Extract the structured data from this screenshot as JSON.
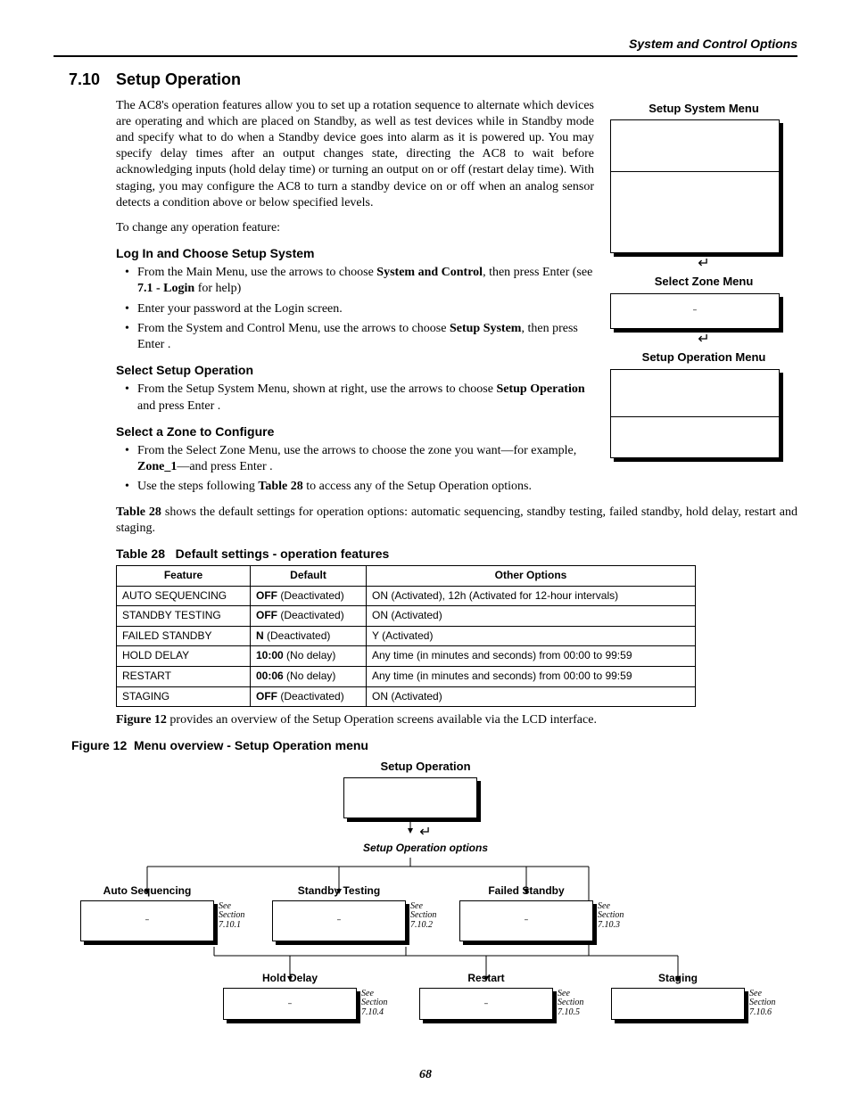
{
  "running_header": "System and Control Options",
  "section": {
    "num": "7.10",
    "title": "Setup Operation"
  },
  "paras": {
    "intro": "The AC8's operation features allow you to set up a rotation sequence to alternate which devices are operating and which are placed on Standby, as well as test devices while in Standby mode and specify what to do when a Standby device goes into alarm as it is powered up. You may specify delay times after an output changes state, directing the AC8 to wait before acknowledging inputs (hold delay time) or turning an output on or off (restart delay time). With staging, you may configure the AC8 to turn a standby device on or off when an analog sensor detects a condition above or below specified levels.",
    "change_any": "To change any operation feature:",
    "sub1": "Log In and Choose Setup System",
    "b1a_pre": "From the Main Menu, use the arrows ",
    "b1a_mid": " to choose ",
    "b1a_bold1": "System and Control",
    "b1a_rest": ", then press Enter  (see ",
    "b1a_bold2": "7.1 - Login",
    "b1a_end": " for help)",
    "b1b": "Enter your password at the Login screen.",
    "b1c_pre": "From the System and Control Menu, use the arrows ",
    "b1c_mid": " to choose ",
    "b1c_bold": "Setup System",
    "b1c_rest": ", then press Enter  .",
    "sub2": "Select Setup Operation",
    "b2a_pre": "From the Setup System Menu, shown at right, use the arrows ",
    "b2a_mid": " to choose ",
    "b2a_bold": "Setup Operation",
    "b2a_rest": " and press Enter  .",
    "sub3": "Select a Zone to Configure",
    "b3a_pre": "From the Select Zone Menu, use the arrows ",
    "b3a_mid": " to choose the zone you want—for example, ",
    "b3a_bold": "Zone_1",
    "b3a_rest": "—and press Enter  .",
    "b3b_pre": "Use the steps following ",
    "b3b_bold": "Table 28",
    "b3b_rest": " to access any of the Setup Operation options.",
    "table_lead_pre": "",
    "table_lead_bold": "Table 28",
    "table_lead_rest": " shows the default settings for operation options: automatic sequencing, standby testing, failed standby, hold delay, restart and staging.",
    "fig_lead_bold": "Figure 12",
    "fig_lead_rest": " provides an overview of the Setup Operation screens available via the LCD interface."
  },
  "side_menus": {
    "m1": "Setup System Menu",
    "m2": "Select Zone Menu",
    "m3": "Setup Operation Menu"
  },
  "table28": {
    "caption_num": "Table 28",
    "caption_txt": "Default settings - operation features",
    "headers": [
      "Feature",
      "Default",
      "Other Options"
    ],
    "rows": [
      {
        "f": "AUTO SEQUENCING",
        "d_bold": "OFF",
        "d_rest": " (Deactivated)",
        "o": "ON (Activated), 12h (Activated for 12-hour intervals)"
      },
      {
        "f": "STANDBY TESTING",
        "d_bold": "OFF",
        "d_rest": " (Deactivated)",
        "o": "ON (Activated)"
      },
      {
        "f": "FAILED STANDBY",
        "d_bold": "N",
        "d_rest": " (Deactivated)",
        "o": "Y (Activated)"
      },
      {
        "f": "HOLD DELAY",
        "d_bold": "10:00",
        "d_rest": " (No delay)",
        "o": "Any time (in minutes and seconds) from 00:00 to 99:59"
      },
      {
        "f": "RESTART",
        "d_bold": "00:06",
        "d_rest": " (No delay)",
        "o": "Any time (in minutes and seconds) from 00:00 to 99:59"
      },
      {
        "f": "STAGING",
        "d_bold": "OFF",
        "d_rest": " (Deactivated)",
        "o": "ON (Activated)"
      }
    ]
  },
  "figure12": {
    "caption_num": "Figure 12",
    "caption_txt": "Menu overview - Setup Operation menu",
    "top_title": "Setup Operation",
    "options_row_title": "Setup Operation options",
    "branches": {
      "b1": {
        "title": "Auto Sequencing",
        "sec": "See Section 7.10.1"
      },
      "b2": {
        "title": "Standby Testing",
        "sec": "See Section 7.10.2"
      },
      "b3": {
        "title": "Failed Standby",
        "sec": "See Section 7.10.3"
      },
      "b4": {
        "title": "Hold Delay",
        "sec": "See Section 7.10.4"
      },
      "b5": {
        "title": "Restart",
        "sec": "See Section 7.10.5"
      },
      "b6": {
        "title": "Staging",
        "sec": "See Section 7.10.6"
      }
    }
  },
  "enter_sym": "↵",
  "page_num": "68"
}
